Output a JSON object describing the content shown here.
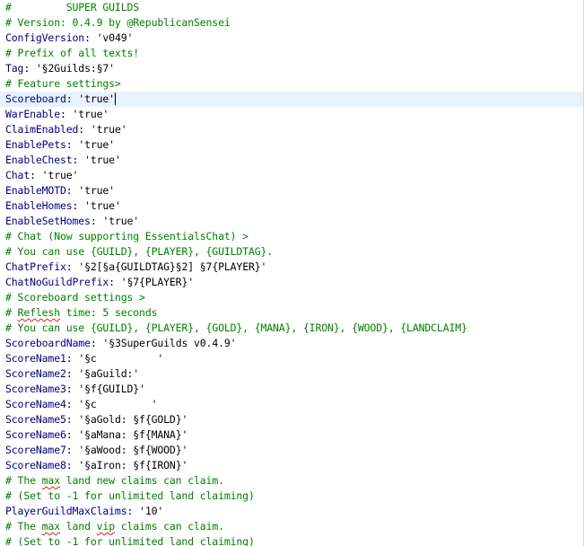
{
  "editor": {
    "current_line_index": 6,
    "lines": [
      {
        "type": "comment",
        "text": "#         SUPER GUILDS"
      },
      {
        "type": "comment",
        "text": "# Version: 0.4.9 by @RepublicanSensei"
      },
      {
        "type": "kv",
        "key": "ConfigVersion",
        "value": "'v049'"
      },
      {
        "type": "comment",
        "text": "# Prefix of all texts!"
      },
      {
        "type": "kv",
        "key": "Tag",
        "value": "'§2Guilds:§7'"
      },
      {
        "type": "comment",
        "text": "# Feature settings>"
      },
      {
        "type": "kv",
        "key": "Scoreboard",
        "value": "'true'"
      },
      {
        "type": "kv",
        "key": "WarEnable",
        "value": "'true'"
      },
      {
        "type": "kv",
        "key": "ClaimEnabled",
        "value": "'true'"
      },
      {
        "type": "kv",
        "key": "EnablePets",
        "value": "'true'"
      },
      {
        "type": "kv",
        "key": "EnableChest",
        "value": "'true'"
      },
      {
        "type": "kv",
        "key": "Chat",
        "value": "'true'"
      },
      {
        "type": "kv",
        "key": "EnableMOTD",
        "value": "'true'"
      },
      {
        "type": "kv",
        "key": "EnableHomes",
        "value": "'true'"
      },
      {
        "type": "kv",
        "key": "EnableSetHomes",
        "value": "'true'"
      },
      {
        "type": "comment",
        "text": "# Chat (Now supporting EssentialsChat) >"
      },
      {
        "type": "comment",
        "text": "# You can use {GUILD}, {PLAYER}, {GUILDTAG}."
      },
      {
        "type": "kv",
        "key": "ChatPrefix",
        "value": "'§2[§a{GUILDTAG}§2] §7{PLAYER}'"
      },
      {
        "type": "kv",
        "key": "ChatNoGuildPrefix",
        "value": "'§7{PLAYER}'"
      },
      {
        "type": "comment",
        "text": "# Scoreboard settings >"
      },
      {
        "type": "comment",
        "text": "# Reflesh time: 5 seconds",
        "misspelled": "Reflesh"
      },
      {
        "type": "comment",
        "text": "# You can use {GUILD}, {PLAYER}, {GOLD}, {MANA}, {IRON}, {WOOD}, {LANDCLAIM}"
      },
      {
        "type": "kv",
        "key": "ScoreboardName",
        "value": "'§3SuperGuilds v0.4.9'"
      },
      {
        "type": "kv",
        "key": "ScoreName1",
        "value": "'§c          '"
      },
      {
        "type": "kv",
        "key": "ScoreName2",
        "value": "'§aGuild:'"
      },
      {
        "type": "kv",
        "key": "ScoreName3",
        "value": "'§f{GUILD}'"
      },
      {
        "type": "kv",
        "key": "ScoreName4",
        "value": "'§c         '"
      },
      {
        "type": "kv",
        "key": "ScoreName5",
        "value": "'§aGold: §f{GOLD}'"
      },
      {
        "type": "kv",
        "key": "ScoreName6",
        "value": "'§aMana: §f{MANA}'"
      },
      {
        "type": "kv",
        "key": "ScoreName7",
        "value": "'§aWood: §f{WOOD}'"
      },
      {
        "type": "kv",
        "key": "ScoreName8",
        "value": "'§aIron: §f{IRON}'"
      },
      {
        "type": "comment",
        "text": "# The max land new claims can claim.",
        "misspelled": "max"
      },
      {
        "type": "comment",
        "text": "# (Set to -1 for unlimited land claiming)"
      },
      {
        "type": "kv",
        "key": "PlayerGuildMaxClaims",
        "value": "'10'"
      },
      {
        "type": "comment",
        "text": "# The max land vip claims can claim.",
        "misspelled": "max vip"
      },
      {
        "type": "comment",
        "text": "# (Set to -1 for unlimited land claiming)"
      }
    ]
  }
}
